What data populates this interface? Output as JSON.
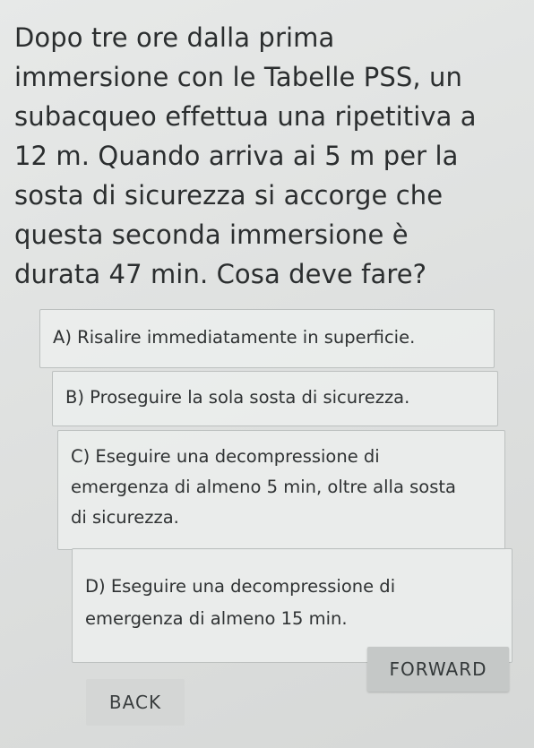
{
  "question": {
    "lines": [
      "Dopo tre ore dalla prima",
      "immersione con le Tabelle PSS, un",
      "subacqueo effettua una ripetitiva a",
      "12 m. Quando arriva ai 5 m per la",
      "sosta di sicurezza si accorge che",
      "questa seconda immersione è",
      "durata 47 min. Cosa deve fare?"
    ]
  },
  "options": [
    {
      "lines": [
        "A) Risalire immediatamente in superﬁcie."
      ]
    },
    {
      "lines": [
        "B) Proseguire la sola sosta di sicurezza."
      ]
    },
    {
      "lines": [
        "C) Eseguire una decompressione di",
        "emergenza di almeno 5 min, oltre alla sosta",
        "di sicurezza."
      ]
    },
    {
      "lines": [
        "D) Eseguire una decompressione di",
        "emergenza di almeno 15 min."
      ]
    }
  ],
  "buttons": {
    "forward": "FORWARD",
    "back": "BACK"
  }
}
